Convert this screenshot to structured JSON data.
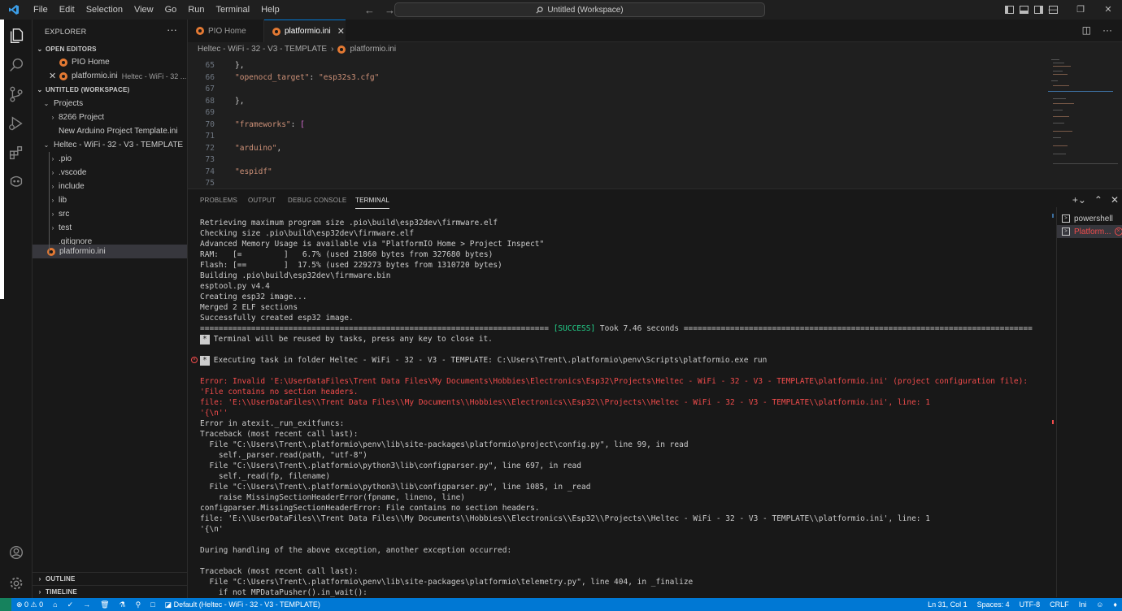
{
  "titlebar": {
    "menus": [
      "File",
      "Edit",
      "Selection",
      "View",
      "Go",
      "Run",
      "Terminal",
      "Help"
    ],
    "command_center": "Untitled (Workspace)"
  },
  "sidebar": {
    "title": "EXPLORER",
    "open_editors_label": "OPEN EDITORS",
    "open_editors": [
      {
        "label": "PIO Home",
        "description": ""
      },
      {
        "label": "platformio.ini",
        "description": "Heltec - WiFi - 32 ..."
      }
    ],
    "workspace_label": "UNTITLED (WORKSPACE)",
    "tree": [
      {
        "label": "Projects"
      },
      {
        "label": "8266 Project"
      },
      {
        "label": "New Arduino Project Template.ini"
      },
      {
        "label": "Heltec - WiFi - 32 - V3 - TEMPLATE"
      },
      {
        "label": ".pio"
      },
      {
        "label": ".vscode"
      },
      {
        "label": "include"
      },
      {
        "label": "lib"
      },
      {
        "label": "src"
      },
      {
        "label": "test"
      },
      {
        "label": ".gitignore"
      },
      {
        "label": "platformio.ini"
      }
    ],
    "outline_label": "OUTLINE",
    "timeline_label": "TIMELINE"
  },
  "tabs": [
    {
      "label": "PIO Home"
    },
    {
      "label": "platformio.ini"
    }
  ],
  "breadcrumb": {
    "folder": "Heltec - WiFi - 32 - V3 - TEMPLATE",
    "file": "platformio.ini"
  },
  "editor": {
    "lines": [
      {
        "num": "65",
        "text": "},"
      },
      {
        "num": "66",
        "key": "\"openocd_target\"",
        "sep": ": ",
        "value": "\"esp32s3.cfg\""
      },
      {
        "num": "67",
        "text": ""
      },
      {
        "num": "68",
        "text": "},"
      },
      {
        "num": "69",
        "text": ""
      },
      {
        "num": "70",
        "key": "\"frameworks\"",
        "sep": ": ",
        "value": "["
      },
      {
        "num": "71",
        "text": ""
      },
      {
        "num": "72",
        "value": "\"arduino\"",
        "sep": ","
      },
      {
        "num": "73",
        "text": ""
      },
      {
        "num": "74",
        "value": "\"espidf\""
      },
      {
        "num": "75",
        "text": ""
      }
    ]
  },
  "panel": {
    "tabs": [
      "PROBLEMS",
      "OUTPUT",
      "DEBUG CONSOLE",
      "TERMINAL"
    ],
    "terminals": [
      {
        "label": "powershell"
      },
      {
        "label": "Platform..."
      }
    ],
    "terminal_lines": [
      "Retrieving maximum program size .pio\\build\\esp32dev\\firmware.elf",
      "Checking size .pio\\build\\esp32dev\\firmware.elf",
      "Advanced Memory Usage is available via \"PlatformIO Home > Project Inspect\"",
      "RAM:   [=         ]   6.7% (used 21860 bytes from 327680 bytes)",
      "Flash: [==        ]  17.5% (used 229273 bytes from 1310720 bytes)",
      "Building .pio\\build\\esp32dev\\firmware.bin",
      "esptool.py v4.4",
      "Creating esp32 image...",
      "Merged 2 ELF sections",
      "Successfully created esp32 image."
    ],
    "success_prefix": "=========================================================================== ",
    "success_word": "[SUCCESS]",
    "success_suffix": " Took 7.46 seconds ===========================================================================",
    "star": "*",
    "reuse_msg": "Terminal will be reused by tasks, press any key to close it.",
    "executing_msg": "Executing task in folder Heltec - WiFi - 32 - V3 - TEMPLATE: C:\\Users\\Trent\\.platformio\\penv\\Scripts\\platformio.exe run",
    "error_lines": [
      "Error: Invalid 'E:\\UserDataFiles\\Trent Data Files\\My Documents\\Hobbies\\Electronics\\Esp32\\Projects\\Heltec - WiFi - 32 - V3 - TEMPLATE\\platformio.ini' (project configuration file):",
      "'File contains no section headers.",
      "file: 'E:\\\\UserDataFiles\\\\Trent Data Files\\\\My Documents\\\\Hobbies\\\\Electronics\\\\Esp32\\\\Projects\\\\Heltec - WiFi - 32 - V3 - TEMPLATE\\\\platformio.ini', line: 1",
      "'{\\n''"
    ],
    "trace_lines": [
      "Error in atexit._run_exitfuncs:",
      "Traceback (most recent call last):",
      "  File \"C:\\Users\\Trent\\.platformio\\penv\\lib\\site-packages\\platformio\\project\\config.py\", line 99, in read",
      "    self._parser.read(path, \"utf-8\")",
      "  File \"C:\\Users\\Trent\\.platformio\\python3\\lib\\configparser.py\", line 697, in read",
      "    self._read(fp, filename)",
      "  File \"C:\\Users\\Trent\\.platformio\\python3\\lib\\configparser.py\", line 1085, in _read",
      "    raise MissingSectionHeaderError(fpname, lineno, line)",
      "configparser.MissingSectionHeaderError: File contains no section headers.",
      "file: 'E:\\\\UserDataFiles\\\\Trent Data Files\\\\My Documents\\\\Hobbies\\\\Electronics\\\\Esp32\\\\Projects\\\\Heltec - WiFi - 32 - V3 - TEMPLATE\\\\platformio.ini', line: 1",
      "'{\\n'",
      "",
      "During handling of the above exception, another exception occurred:",
      "",
      "Traceback (most recent call last):",
      "  File \"C:\\Users\\Trent\\.platformio\\penv\\lib\\site-packages\\platformio\\telemetry.py\", line 404, in _finalize",
      "    if not MPDataPusher().in_wait():"
    ]
  },
  "statusbar": {
    "problems": "⊗ 0 ⚠ 0",
    "env": "Default (Heltec - WiFi - 32 - V3 - TEMPLATE)",
    "position": "Ln 31, Col 1",
    "spaces": "Spaces: 4",
    "encoding": "UTF-8",
    "eol": "CRLF",
    "language": "Ini"
  },
  "colors": {
    "accent": "#0078d4",
    "error": "#f14c4c",
    "success": "#23d18b",
    "string": "#ce9178"
  }
}
